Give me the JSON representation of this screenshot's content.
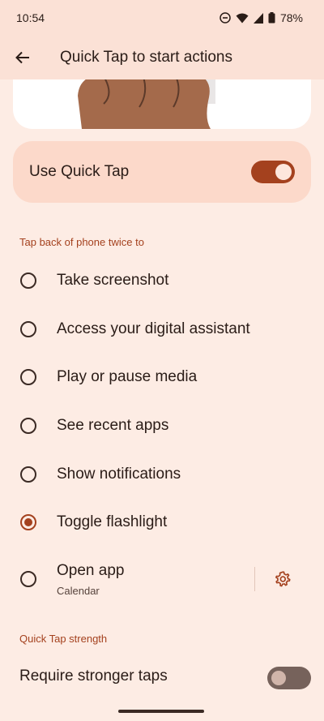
{
  "status_bar": {
    "time": "10:54",
    "battery": "78%"
  },
  "app_bar": {
    "title": "Quick Tap to start actions"
  },
  "master_switch": {
    "label": "Use Quick Tap",
    "on": true
  },
  "actions_section": {
    "header": "Tap back of phone twice to",
    "options": [
      {
        "label": "Take screenshot",
        "selected": false
      },
      {
        "label": "Access your digital assistant",
        "selected": false
      },
      {
        "label": "Play or pause media",
        "selected": false
      },
      {
        "label": "See recent apps",
        "selected": false
      },
      {
        "label": "Show notifications",
        "selected": false
      },
      {
        "label": "Toggle flashlight",
        "selected": true
      },
      {
        "label": "Open app",
        "sublabel": "Calendar",
        "selected": false
      }
    ]
  },
  "strength_section": {
    "header": "Quick Tap strength",
    "require_stronger": {
      "label": "Require stronger taps",
      "on": false
    }
  },
  "colors": {
    "accent": "#a4411e",
    "background": "#fdece4",
    "card": "#fcd9ca"
  }
}
